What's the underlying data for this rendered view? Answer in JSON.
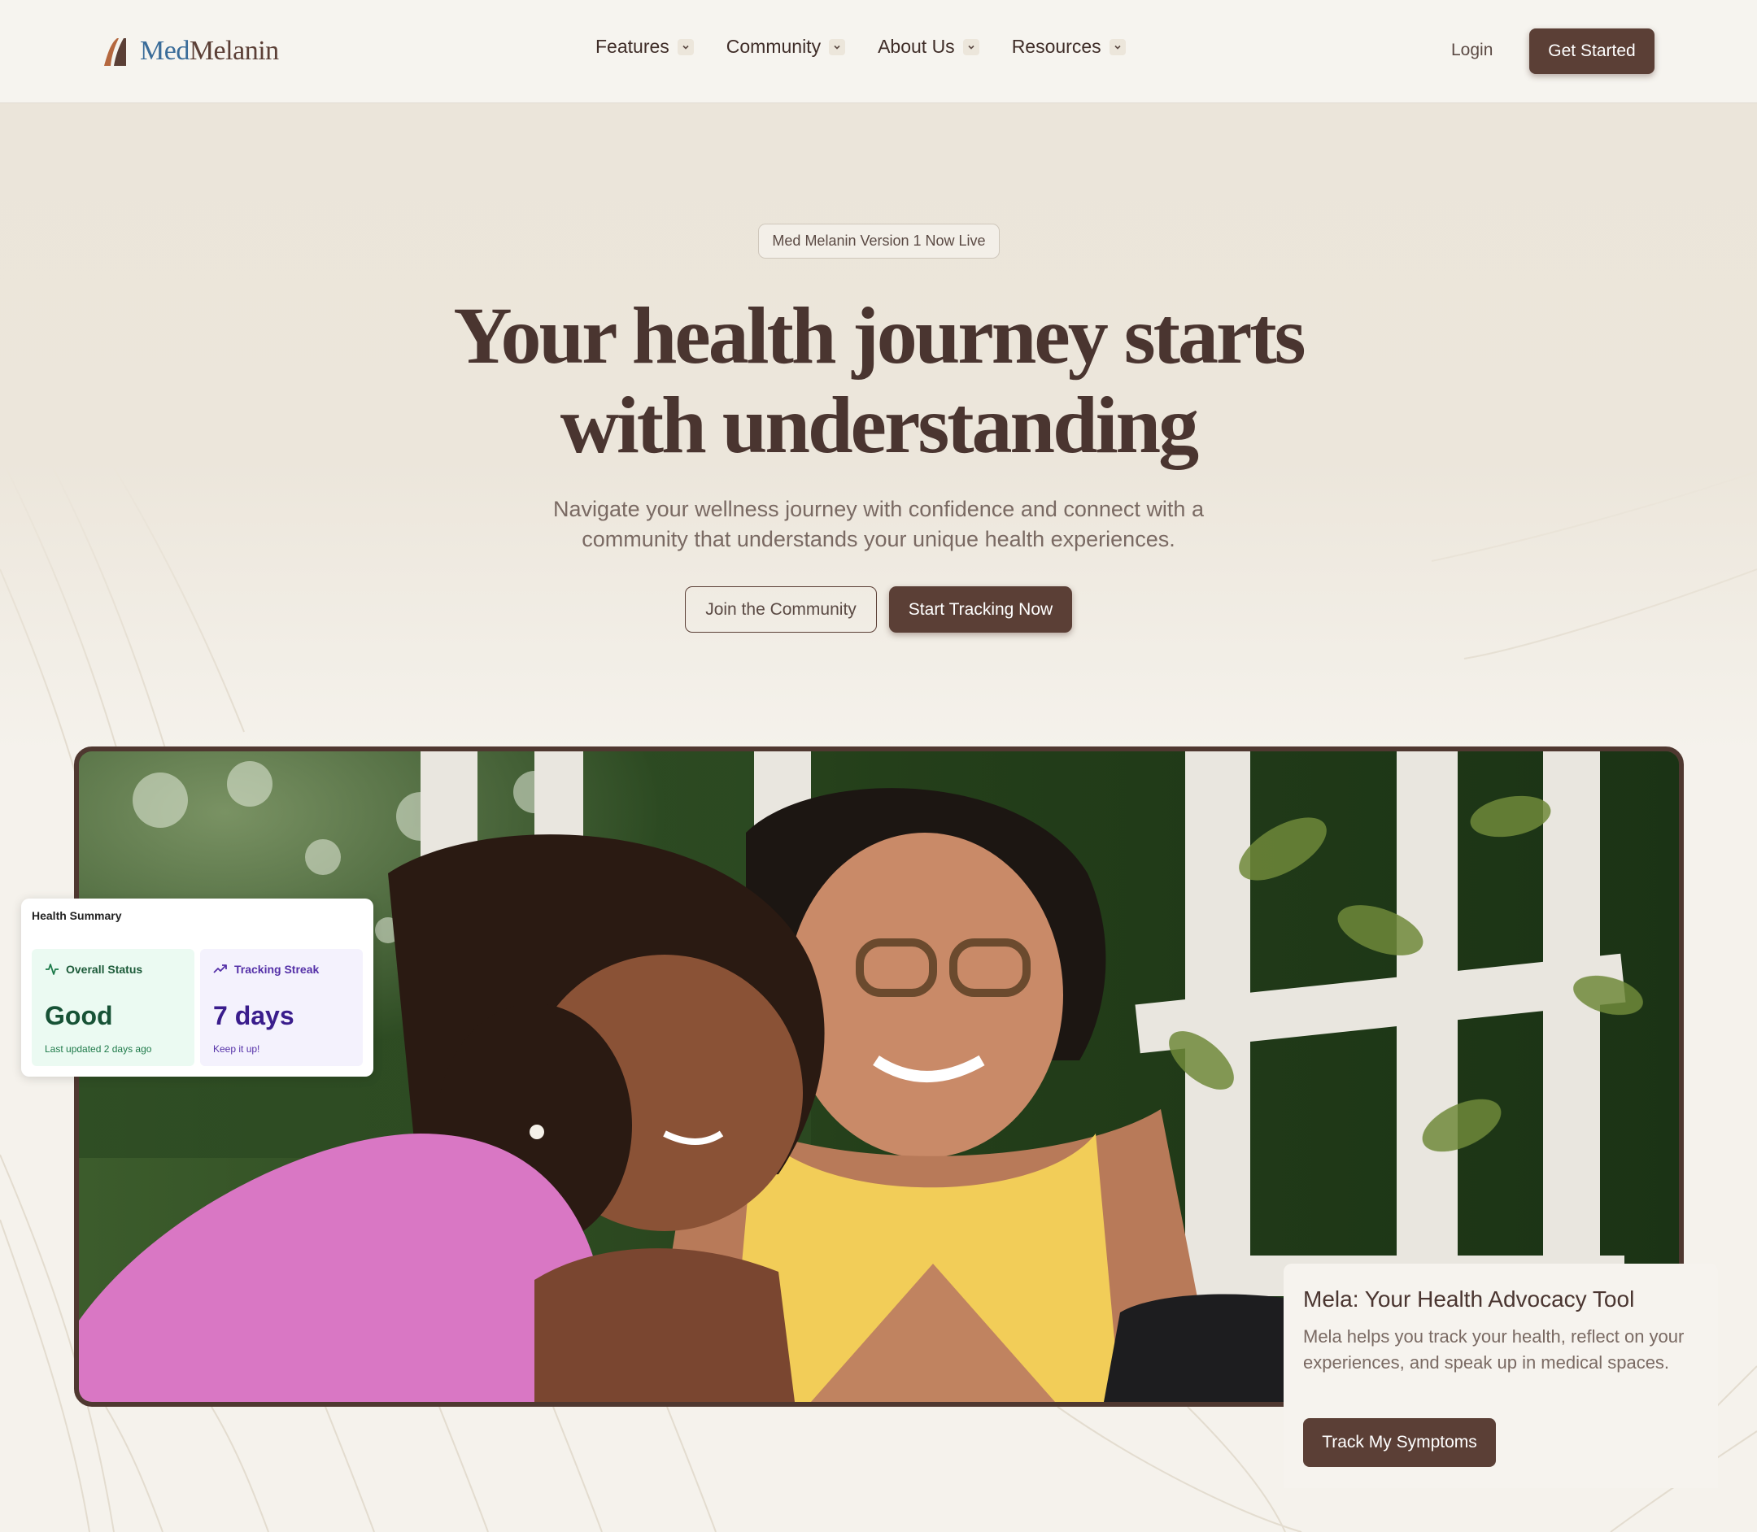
{
  "nav": {
    "logo_prefix": "Med",
    "logo_suffix": "Melanin",
    "menu": [
      {
        "label": "Features"
      },
      {
        "label": "Community"
      },
      {
        "label": "About Us"
      },
      {
        "label": "Resources"
      }
    ],
    "login_label": "Login",
    "cta_label": "Get Started"
  },
  "hero": {
    "badge": "Med Melanin Version 1 Now Live",
    "headline_line1": "Your health journey starts",
    "headline_line2": "with understanding",
    "subtitle_line1": "Navigate your wellness journey with confidence and connect with a",
    "subtitle_line2": "community that understands your unique health experiences.",
    "secondary_cta": "Join the Community",
    "primary_cta": "Start Tracking Now"
  },
  "health_summary": {
    "title": "Health Summary",
    "overall_status": {
      "label": "Overall Status",
      "value": "Good",
      "note": "Last updated 2 days ago",
      "icon": "activity-icon"
    },
    "tracking_streak": {
      "label": "Tracking Streak",
      "value": "7 days",
      "note": "Keep it up!",
      "icon": "trending-up-icon"
    }
  },
  "mela": {
    "title": "Mela: Your Health Advocacy Tool",
    "description": "Mela helps you track your health, reflect on your experiences, and speak up in medical spaces.",
    "cta": "Track My Symptoms"
  },
  "colors": {
    "brand_brown": "#5b3f36",
    "logo_blue": "#3a6c99",
    "background": "#f5f2ec",
    "status_green": "#175236",
    "streak_purple": "#3a1d8c"
  }
}
